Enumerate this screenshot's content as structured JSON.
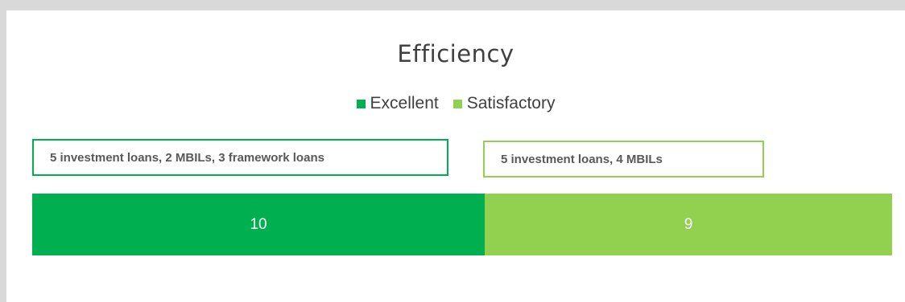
{
  "chart_data": {
    "type": "bar",
    "orientation": "horizontal-stacked",
    "title": "Efficiency",
    "legend": {
      "placement": "top-center",
      "entries": [
        "Excellent",
        "Satisfactory"
      ]
    },
    "categories": [
      ""
    ],
    "series": [
      {
        "name": "Excellent",
        "values": [
          10
        ],
        "color": "#00b050",
        "data_label": "10",
        "annotation": "5 investment loans, 2 MBILs, 3 framework loans"
      },
      {
        "name": "Satisfactory",
        "values": [
          9
        ],
        "color": "#92d050",
        "data_label": "9",
        "annotation": "5 investment loans, 4 MBILs"
      }
    ],
    "xlim": [
      0,
      19
    ],
    "grid": false
  },
  "colors": {
    "background": "#d9d9d9",
    "card": "#ffffff",
    "title_text": "#404040",
    "annotation_text": "#595959"
  }
}
